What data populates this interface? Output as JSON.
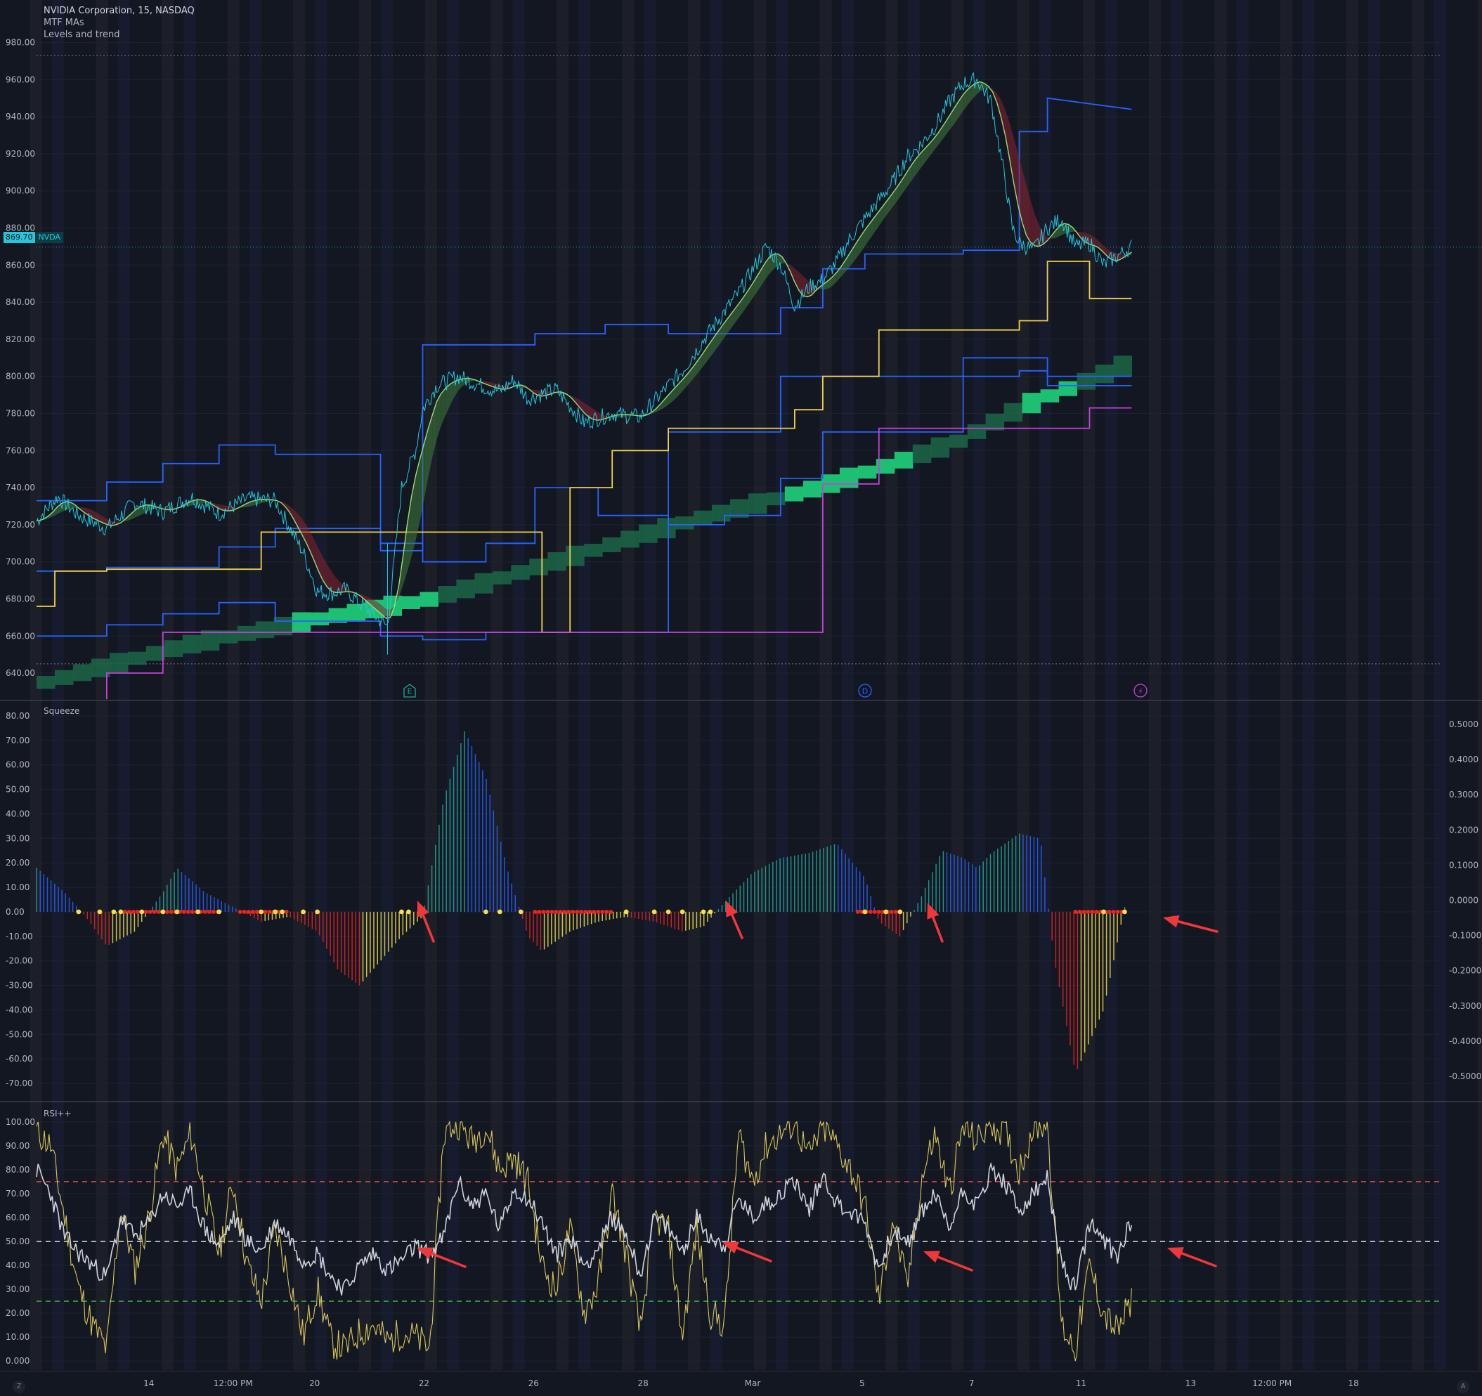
{
  "header": {
    "title": "NVIDIA Corporation, 15, NASDAQ",
    "indicator_1": "MTF MAs",
    "indicator_2": "Levels and trend"
  },
  "price_badge": {
    "value": "869.70",
    "ticker": "NVDA"
  },
  "panes": {
    "squeeze_label": "Squeeze",
    "rsi_label": "RSI++"
  },
  "markers": {
    "earnings": "E",
    "dividend": "D",
    "split": "⚡"
  },
  "corners": {
    "left": "Z",
    "right": "A"
  },
  "colors": {
    "background": "#131722",
    "price": "#26c6da",
    "level_blue": "#2962ff",
    "level_yellow": "#f0d04a",
    "level_purple": "#c243d6",
    "trend_band": "#1ec977",
    "ma_up": "#a7f07a",
    "ma_down": "#e0384b",
    "squeeze_dot_on": "#e52521",
    "squeeze_dot_off": "#f5e04a",
    "rsi_main": "#d0d3da",
    "rsi_fast": "#d9c85a",
    "ob_line": "#ef5350",
    "os_line": "#4caf50",
    "arrow": "#f0383b"
  },
  "x_axis": {
    "labels": [
      {
        "text": "14",
        "t": 0.08
      },
      {
        "text": "12:00 PM",
        "t": 0.14
      },
      {
        "text": "20",
        "t": 0.198
      },
      {
        "text": "22",
        "t": 0.276
      },
      {
        "text": "26",
        "t": 0.354
      },
      {
        "text": "28",
        "t": 0.432
      },
      {
        "text": "Mar",
        "t": 0.51
      },
      {
        "text": "5",
        "t": 0.588
      },
      {
        "text": "7",
        "t": 0.666
      },
      {
        "text": "11",
        "t": 0.744
      },
      {
        "text": "13",
        "t": 0.822
      },
      {
        "text": "12:00 PM",
        "t": 0.88
      },
      {
        "text": "18",
        "t": 0.938
      }
    ]
  },
  "chart_data": [
    {
      "type": "line",
      "title": "NVIDIA Corporation, 15, NASDAQ",
      "y_ticks": [
        980,
        960,
        940,
        920,
        900,
        880,
        860,
        840,
        820,
        800,
        780,
        760,
        740,
        720,
        700,
        680,
        660,
        640
      ],
      "ylim": [
        626,
        984
      ],
      "last_price": 869.7,
      "series": [
        {
          "key": "close",
          "x": [
            0,
            0.015,
            0.03,
            0.05,
            0.07,
            0.09,
            0.11,
            0.13,
            0.15,
            0.17,
            0.19,
            0.2,
            0.21,
            0.22,
            0.23,
            0.25,
            0.26,
            0.27,
            0.275,
            0.285,
            0.3,
            0.32,
            0.33,
            0.34,
            0.35,
            0.37,
            0.39,
            0.41,
            0.43,
            0.45,
            0.46,
            0.48,
            0.5,
            0.52,
            0.53,
            0.54,
            0.55,
            0.56,
            0.57,
            0.58,
            0.59,
            0.6,
            0.61,
            0.62,
            0.63,
            0.64,
            0.65,
            0.66,
            0.67,
            0.68,
            0.69,
            0.695,
            0.7,
            0.71,
            0.72,
            0.73,
            0.74,
            0.75,
            0.76,
            0.77,
            0.78
          ],
          "y": [
            722,
            735,
            725,
            718,
            732,
            727,
            735,
            726,
            734,
            733,
            705,
            684,
            683,
            685,
            678,
            665,
            740,
            760,
            782,
            795,
            800,
            794,
            792,
            798,
            788,
            793,
            775,
            780,
            778,
            795,
            803,
            825,
            845,
            870,
            860,
            838,
            848,
            852,
            862,
            875,
            885,
            895,
            905,
            918,
            925,
            935,
            948,
            958,
            960,
            948,
            905,
            880,
            872,
            868,
            880,
            885,
            870,
            872,
            860,
            865,
            870
          ]
        },
        {
          "key": "level_blue_top",
          "x": [
            0,
            0.05,
            0.05,
            0.09,
            0.09,
            0.13,
            0.13,
            0.17,
            0.17,
            0.245,
            0.245,
            0.275,
            0.275,
            0.355,
            0.355,
            0.405,
            0.405,
            0.45,
            0.45,
            0.49,
            0.49,
            0.53,
            0.53,
            0.56,
            0.56,
            0.59,
            0.59,
            0.66,
            0.66,
            0.7,
            0.7,
            0.72,
            0.72,
            0.78
          ],
          "y": [
            733,
            733,
            743,
            743,
            753,
            753,
            763,
            763,
            758,
            758,
            706,
            706,
            817,
            817,
            823,
            823,
            828,
            828,
            823,
            823,
            823,
            823,
            837,
            837,
            858,
            858,
            866,
            866,
            868,
            868,
            932,
            932,
            950,
            944
          ]
        },
        {
          "key": "level_blue_mid",
          "x": [
            0,
            0.05,
            0.05,
            0.13,
            0.13,
            0.17,
            0.17,
            0.245,
            0.245,
            0.275,
            0.275,
            0.32,
            0.32,
            0.355,
            0.355,
            0.4,
            0.4,
            0.45,
            0.45,
            0.49,
            0.49,
            0.53,
            0.53,
            0.56,
            0.56,
            0.59,
            0.59,
            0.66,
            0.66,
            0.7,
            0.7,
            0.72,
            0.72,
            0.78
          ],
          "y": [
            695,
            695,
            697,
            697,
            708,
            708,
            718,
            718,
            710,
            710,
            700,
            700,
            710,
            710,
            740,
            740,
            725,
            725,
            720,
            720,
            725,
            725,
            745,
            745,
            770,
            770,
            770,
            770,
            800,
            800,
            803,
            803,
            795,
            795
          ]
        },
        {
          "key": "level_blue_low",
          "x": [
            0,
            0.05,
            0.05,
            0.09,
            0.09,
            0.13,
            0.13,
            0.17,
            0.17,
            0.245,
            0.245,
            0.275,
            0.275,
            0.32,
            0.32,
            0.355,
            0.355,
            0.45,
            0.45,
            0.53,
            0.53,
            0.66,
            0.66,
            0.72,
            0.72,
            0.78
          ],
          "y": [
            660,
            660,
            666,
            666,
            672,
            672,
            678,
            678,
            668,
            668,
            660,
            660,
            658,
            658,
            662,
            662,
            662,
            662,
            770,
            770,
            800,
            800,
            810,
            810,
            800,
            800
          ]
        },
        {
          "key": "level_yellow",
          "x": [
            0,
            0.013,
            0.013,
            0.05,
            0.05,
            0.13,
            0.13,
            0.16,
            0.16,
            0.2,
            0.2,
            0.36,
            0.36,
            0.38,
            0.38,
            0.41,
            0.41,
            0.45,
            0.45,
            0.54,
            0.54,
            0.56,
            0.56,
            0.6,
            0.6,
            0.66,
            0.66,
            0.7,
            0.7,
            0.72,
            0.72,
            0.75,
            0.75,
            0.78
          ],
          "y": [
            676,
            676,
            695,
            695,
            696,
            696,
            696,
            696,
            716,
            716,
            716,
            716,
            662,
            662,
            740,
            740,
            760,
            760,
            772,
            772,
            782,
            782,
            800,
            800,
            825,
            825,
            825,
            825,
            830,
            830,
            862,
            862,
            842,
            842
          ]
        },
        {
          "key": "level_purple",
          "x": [
            0.05,
            0.05,
            0.09,
            0.09,
            0.245,
            0.245,
            0.56,
            0.56,
            0.6,
            0.6,
            0.75,
            0.75,
            0.78
          ],
          "y": [
            626,
            640,
            640,
            662,
            662,
            662,
            662,
            742,
            742,
            772,
            772,
            783,
            783
          ]
        },
        {
          "key": "trend_band_mid",
          "x": [
            0,
            0.1,
            0.2,
            0.275,
            0.35,
            0.45,
            0.55,
            0.6,
            0.65,
            0.7,
            0.75,
            0.78
          ],
          "y": [
            635,
            655,
            670,
            680,
            697,
            720,
            740,
            752,
            765,
            785,
            800,
            810
          ]
        }
      ]
    },
    {
      "type": "bar",
      "title": "Squeeze",
      "y_ticks": [
        80,
        70,
        60,
        50,
        40,
        30,
        20,
        10,
        0,
        -10,
        -20,
        -30,
        -40,
        -50,
        -60,
        -70
      ],
      "right_ticks": [
        "0.5000",
        "0.4000",
        "0.3000",
        "0.2000",
        "0.1000",
        "0.0000",
        "-0.1000",
        "-0.2000",
        "-0.3000",
        "-0.4000",
        "-0.5000"
      ],
      "ylim": [
        -74,
        82
      ],
      "series": [
        {
          "key": "momentum",
          "x": [
            0,
            0.02,
            0.035,
            0.05,
            0.07,
            0.09,
            0.1,
            0.12,
            0.14,
            0.16,
            0.18,
            0.2,
            0.215,
            0.23,
            0.245,
            0.26,
            0.275,
            0.29,
            0.305,
            0.32,
            0.335,
            0.35,
            0.36,
            0.38,
            0.4,
            0.42,
            0.44,
            0.46,
            0.475,
            0.49,
            0.51,
            0.53,
            0.55,
            0.57,
            0.59,
            0.6,
            0.615,
            0.63,
            0.645,
            0.66,
            0.67,
            0.68,
            0.7,
            0.715,
            0.725,
            0.74,
            0.76,
            0.775
          ],
          "y": [
            18,
            8,
            -2,
            -14,
            -8,
            8,
            18,
            8,
            2,
            -4,
            -2,
            -8,
            -24,
            -30,
            -20,
            -10,
            -2,
            46,
            74,
            55,
            18,
            -10,
            -16,
            -8,
            -4,
            -2,
            -4,
            -8,
            -6,
            4,
            16,
            22,
            24,
            28,
            14,
            -4,
            -10,
            6,
            25,
            22,
            18,
            24,
            32,
            30,
            -20,
            -66,
            -40,
            2
          ]
        },
        {
          "key": "squeeze_dots_on",
          "ranges": [
            [
              0.06,
              0.13
            ],
            [
              0.145,
              0.18
            ],
            [
              0.355,
              0.41
            ],
            [
              0.585,
              0.615
            ],
            [
              0.74,
              0.775
            ]
          ]
        },
        {
          "key": "squeeze_dots_off",
          "points": [
            0.03,
            0.045,
            0.055,
            0.06,
            0.075,
            0.09,
            0.1,
            0.115,
            0.13,
            0.16,
            0.17,
            0.175,
            0.19,
            0.2,
            0.26,
            0.265,
            0.275,
            0.32,
            0.33,
            0.345,
            0.42,
            0.44,
            0.45,
            0.46,
            0.475,
            0.48,
            0.59,
            0.605,
            0.615,
            0.76,
            0.775
          ]
        }
      ]
    },
    {
      "type": "line",
      "title": "RSI++",
      "y_ticks": [
        100,
        90,
        80,
        70,
        60,
        50,
        40,
        30,
        20,
        10,
        0
      ],
      "ylim": [
        -2,
        102
      ],
      "levels": {
        "overbought": 75,
        "mid": 50,
        "oversold": 25
      },
      "series": [
        {
          "key": "rsi",
          "x": [
            0,
            0.01,
            0.02,
            0.03,
            0.04,
            0.05,
            0.06,
            0.07,
            0.08,
            0.09,
            0.1,
            0.11,
            0.12,
            0.13,
            0.14,
            0.15,
            0.16,
            0.17,
            0.18,
            0.19,
            0.2,
            0.21,
            0.22,
            0.23,
            0.24,
            0.25,
            0.26,
            0.27,
            0.28,
            0.29,
            0.3,
            0.31,
            0.32,
            0.33,
            0.34,
            0.35,
            0.36,
            0.37,
            0.38,
            0.39,
            0.4,
            0.41,
            0.42,
            0.43,
            0.44,
            0.45,
            0.46,
            0.47,
            0.48,
            0.49,
            0.5,
            0.51,
            0.52,
            0.53,
            0.54,
            0.55,
            0.56,
            0.57,
            0.58,
            0.59,
            0.6,
            0.61,
            0.62,
            0.63,
            0.64,
            0.65,
            0.66,
            0.67,
            0.68,
            0.69,
            0.7,
            0.71,
            0.72,
            0.73,
            0.74,
            0.75,
            0.76,
            0.77,
            0.78
          ],
          "y": [
            80,
            70,
            52,
            45,
            40,
            35,
            60,
            52,
            58,
            70,
            65,
            70,
            55,
            48,
            60,
            50,
            46,
            58,
            52,
            42,
            45,
            35,
            30,
            40,
            45,
            38,
            42,
            48,
            44,
            52,
            75,
            65,
            70,
            55,
            72,
            68,
            58,
            44,
            52,
            40,
            47,
            60,
            53,
            36,
            60,
            55,
            46,
            60,
            52,
            48,
            68,
            60,
            66,
            70,
            76,
            63,
            78,
            66,
            62,
            58,
            38,
            55,
            48,
            62,
            70,
            55,
            72,
            65,
            80,
            74,
            62,
            70,
            76,
            40,
            30,
            58,
            50,
            44,
            60
          ]
        },
        {
          "key": "rsi_fast",
          "x": [
            0,
            0.01,
            0.02,
            0.03,
            0.04,
            0.05,
            0.06,
            0.07,
            0.08,
            0.09,
            0.1,
            0.11,
            0.12,
            0.13,
            0.14,
            0.15,
            0.16,
            0.17,
            0.18,
            0.19,
            0.2,
            0.21,
            0.22,
            0.23,
            0.24,
            0.25,
            0.26,
            0.27,
            0.28,
            0.29,
            0.3,
            0.31,
            0.32,
            0.33,
            0.34,
            0.35,
            0.36,
            0.37,
            0.38,
            0.39,
            0.4,
            0.41,
            0.42,
            0.43,
            0.44,
            0.45,
            0.46,
            0.47,
            0.48,
            0.49,
            0.5,
            0.51,
            0.52,
            0.53,
            0.54,
            0.55,
            0.56,
            0.57,
            0.58,
            0.59,
            0.6,
            0.61,
            0.62,
            0.63,
            0.64,
            0.65,
            0.66,
            0.67,
            0.68,
            0.69,
            0.7,
            0.71,
            0.72,
            0.73,
            0.74,
            0.75,
            0.76,
            0.77,
            0.78
          ],
          "y": [
            96,
            90,
            60,
            30,
            15,
            5,
            65,
            38,
            60,
            95,
            80,
            95,
            70,
            45,
            75,
            40,
            25,
            55,
            35,
            10,
            30,
            8,
            5,
            12,
            15,
            8,
            12,
            10,
            5,
            95,
            100,
            92,
            98,
            80,
            85,
            75,
            40,
            30,
            55,
            20,
            32,
            70,
            45,
            12,
            60,
            55,
            10,
            55,
            20,
            15,
            95,
            75,
            90,
            95,
            100,
            85,
            98,
            90,
            80,
            65,
            25,
            60,
            30,
            75,
            95,
            70,
            98,
            92,
            100,
            95,
            80,
            98,
            100,
            15,
            5,
            40,
            20,
            12,
            25
          ]
        }
      ]
    }
  ]
}
